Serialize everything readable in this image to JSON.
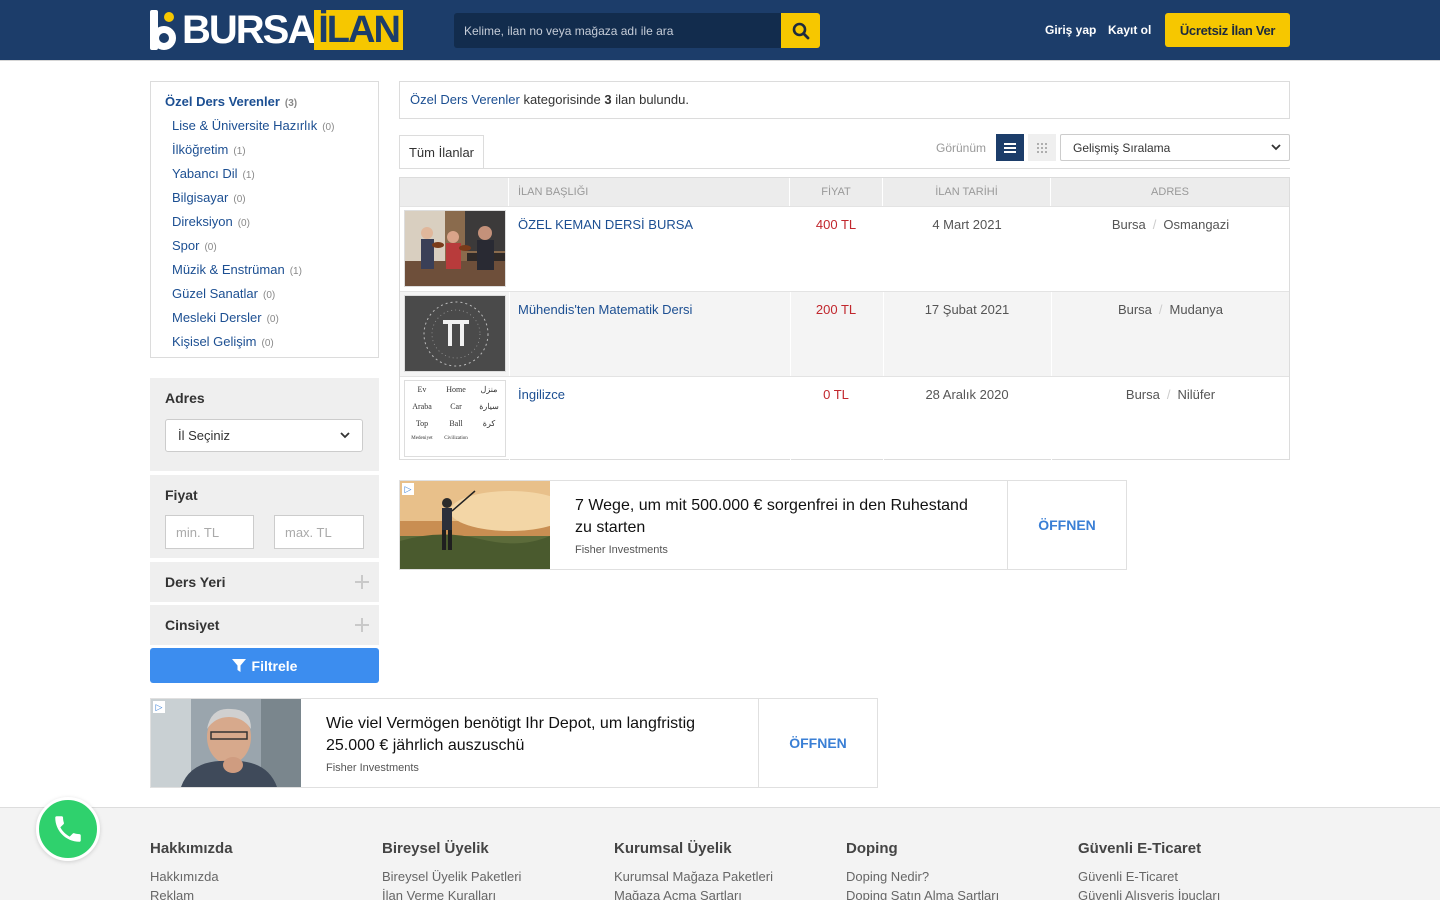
{
  "header": {
    "logo_bursa": "BURSA",
    "logo_ilan": "İLAN",
    "search_placeholder": "Kelime, ilan no veya mağaza adı ile ara",
    "login": "Giriş yap",
    "register": "Kayıt ol",
    "cta": "Ücretsiz İlan Ver",
    "colors": {
      "navy": "#1c3d6a",
      "accent": "#f6c700"
    }
  },
  "sidebar": {
    "main_category": {
      "label": "Özel Ders Verenler",
      "count": "(3)"
    },
    "categories": [
      {
        "label": "Lise & Üniversite Hazırlık",
        "count": "(0)"
      },
      {
        "label": "İlköğretim",
        "count": "(1)"
      },
      {
        "label": "Yabancı Dil",
        "count": "(1)"
      },
      {
        "label": "Bilgisayar",
        "count": "(0)"
      },
      {
        "label": "Direksiyon",
        "count": "(0)"
      },
      {
        "label": "Spor",
        "count": "(0)"
      },
      {
        "label": "Müzik & Enstrüman",
        "count": "(1)"
      },
      {
        "label": "Güzel Sanatlar",
        "count": "(0)"
      },
      {
        "label": "Mesleki Dersler",
        "count": "(0)"
      },
      {
        "label": "Kişisel Gelişim",
        "count": "(0)"
      }
    ],
    "address_title": "Adres",
    "city_select": "İl Seçiniz",
    "price_title": "Fiyat",
    "price_min_placeholder": "min. TL",
    "price_max_placeholder": "max. TL",
    "lesson_place": "Ders Yeri",
    "gender": "Cinsiyet",
    "filter_button": "Filtrele"
  },
  "main": {
    "info_link": "Özel Ders Verenler",
    "info_mid": " kategorisinde ",
    "info_count": "3",
    "info_end": " ilan bulundu.",
    "tab_all": "Tüm İlanlar",
    "view_label": "Görünüm",
    "sort_value": "Gelişmiş Sıralama",
    "columns": {
      "title": "İLAN BAŞLIĞI",
      "price": "FİYAT",
      "date": "İLAN TARİHİ",
      "address": "ADRES"
    },
    "listings": [
      {
        "title": "ÖZEL KEMAN DERSİ BURSA",
        "price": "400 TL",
        "date": "4 Mart 2021",
        "city": "Bursa",
        "district": "Osmangazi"
      },
      {
        "title": "Mühendis'ten Matematik Dersi",
        "price": "200 TL",
        "date": "17 Şubat 2021",
        "city": "Bursa",
        "district": "Mudanya"
      },
      {
        "title": "İngilizce",
        "price": "0 TL",
        "date": "28 Aralık 2020",
        "city": "Bursa",
        "district": "Nilüfer"
      }
    ],
    "thumb3_words": [
      "Ev",
      "Home",
      "منزل",
      "Araba",
      "Car",
      "سيارة",
      "Top",
      "Ball",
      "كرة",
      "Medeniyet",
      "Civilization"
    ]
  },
  "ads": [
    {
      "text": "7 Wege, um mit 500.000 € sorgenfrei in den Ruhestand zu starten",
      "source": "Fisher Investments",
      "cta": "ÖFFNEN"
    },
    {
      "text": "Wie viel Vermögen benötigt Ihr Depot, um langfristig 25.000 € jährlich auszuschü",
      "source": "Fisher Investments",
      "cta": "ÖFFNEN"
    }
  ],
  "footer": [
    {
      "heading": "Hakkımızda",
      "link1": "Hakkımızda",
      "link2": "Reklam"
    },
    {
      "heading": "Bireysel Üyelik",
      "link1": "Bireysel Üyelik Paketleri",
      "link2": "İlan Verme Kuralları"
    },
    {
      "heading": "Kurumsal Üyelik",
      "link1": "Kurumsal Mağaza Paketleri",
      "link2": "Mağaza Açma Şartları"
    },
    {
      "heading": "Doping",
      "link1": "Doping Nedir?",
      "link2": "Doping Satın Alma Şartları"
    },
    {
      "heading": "Güvenli E-Ticaret",
      "link1": "Güvenli E-Ticaret",
      "link2": "Güvenli Alışveriş İpuçları"
    }
  ]
}
